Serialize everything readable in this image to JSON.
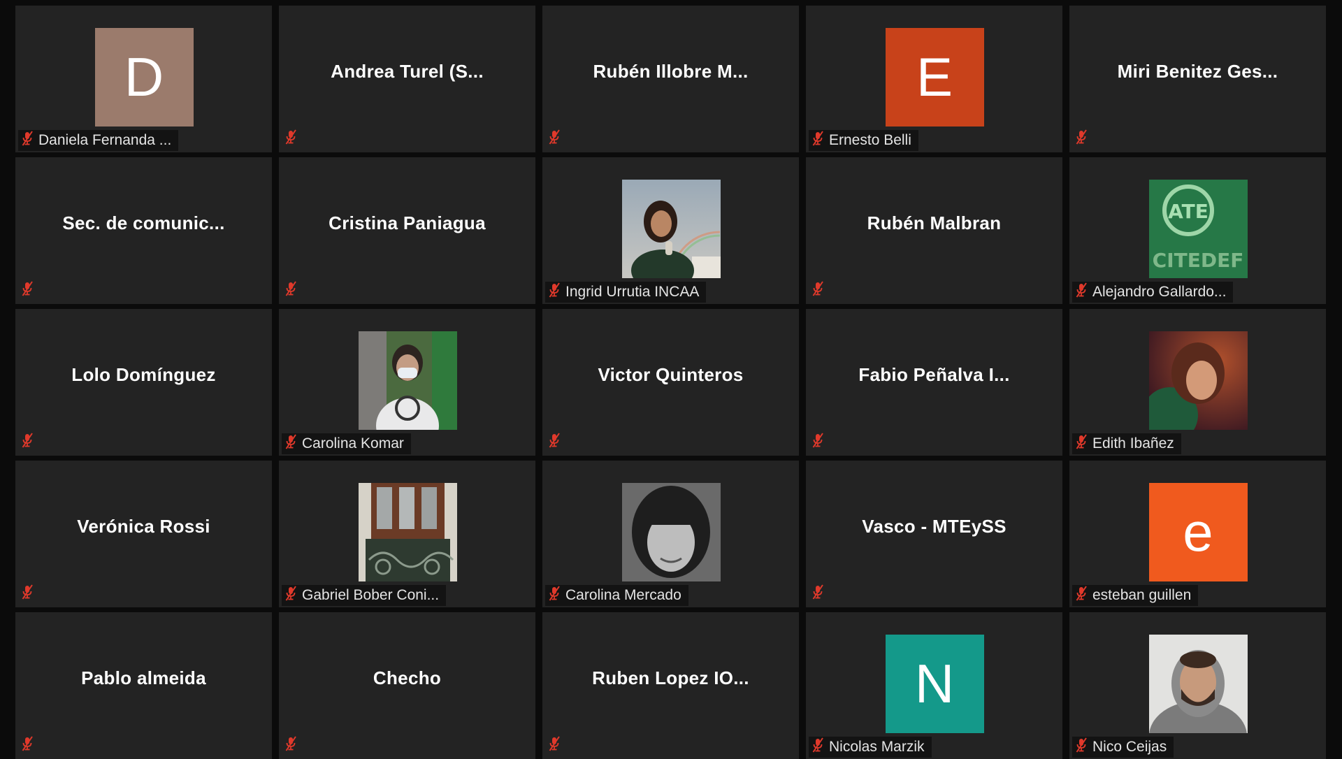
{
  "participants": [
    {
      "type": "avatar-letter",
      "letter": "D",
      "color": "#9b7b6c",
      "name": "Daniela Fernanda ..."
    },
    {
      "type": "name-only",
      "name": "Andrea Turel (S..."
    },
    {
      "type": "name-only",
      "name": "Rubén Illobre M..."
    },
    {
      "type": "avatar-letter",
      "letter": "E",
      "color": "#c8421a",
      "name": "Ernesto Belli"
    },
    {
      "type": "name-only",
      "name": "Miri Benitez Ges..."
    },
    {
      "type": "name-only",
      "name": "Sec. de comunic..."
    },
    {
      "type": "name-only",
      "name": "Cristina Paniagua"
    },
    {
      "type": "photo",
      "photo": "woman-rainbow-photo",
      "name": "Ingrid Urrutia INCAA"
    },
    {
      "type": "name-only",
      "name": "Rubén Malbran"
    },
    {
      "type": "photo",
      "photo": "ate-citedef-logo",
      "logo_text": "ATE",
      "logo_subtext": "CITEDEF",
      "name": "Alejandro Gallardo..."
    },
    {
      "type": "name-only",
      "name": "Lolo Domínguez"
    },
    {
      "type": "photo",
      "photo": "woman-mask-photo",
      "name": "Carolina Komar"
    },
    {
      "type": "name-only",
      "name": "Victor Quinteros"
    },
    {
      "type": "name-only",
      "name": "Fabio Peñalva I..."
    },
    {
      "type": "photo",
      "photo": "woman-smiling-photo",
      "name": "Edith Ibañez"
    },
    {
      "type": "name-only",
      "name": "Verónica Rossi"
    },
    {
      "type": "photo",
      "photo": "building-door-photo",
      "name": "Gabriel Bober Coni..."
    },
    {
      "type": "photo",
      "photo": "woman-bw-photo",
      "name": "Carolina Mercado"
    },
    {
      "type": "name-only",
      "name": "Vasco - MTEySS"
    },
    {
      "type": "avatar-letter",
      "letter": "e",
      "color": "#f05a1e",
      "name": "esteban guillen"
    },
    {
      "type": "name-only",
      "name": "Pablo almeida"
    },
    {
      "type": "name-only",
      "name": "Checho"
    },
    {
      "type": "name-only",
      "name": "Ruben Lopez IO..."
    },
    {
      "type": "avatar-letter",
      "letter": "N",
      "color": "#14998a",
      "name": "Nicolas Marzik"
    },
    {
      "type": "photo",
      "photo": "man-hoodie-photo",
      "name": "Nico Ceijas"
    }
  ],
  "icons": {
    "muted_mic": "muted-mic-icon"
  },
  "colors": {
    "tile_bg": "#232323",
    "page_bg": "#0b0b0b",
    "mute_red": "#e0392b"
  }
}
